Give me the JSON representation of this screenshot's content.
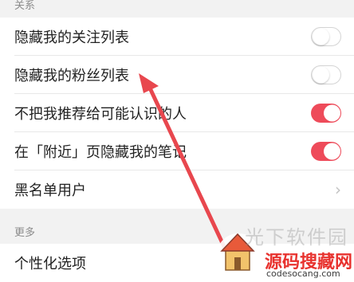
{
  "sections": [
    {
      "title": "关系",
      "items": [
        {
          "label": "隐藏我的关注列表",
          "control": "toggle",
          "on": false
        },
        {
          "label": "隐藏我的粉丝列表",
          "control": "toggle",
          "on": false
        },
        {
          "label": "不把我推荐给可能认识的人",
          "control": "toggle",
          "on": true
        },
        {
          "label": "在「附近」页隐藏我的笔记",
          "control": "toggle",
          "on": true
        },
        {
          "label": "黑名单用户",
          "control": "chevron"
        }
      ]
    },
    {
      "title": "更多",
      "items": [
        {
          "label": "个性化选项",
          "control": "none"
        }
      ]
    }
  ],
  "colors": {
    "accent": "#ee4b5a",
    "annotation_arrow": "#e8474e"
  },
  "icons": {
    "chevron": "chevron-right-icon"
  },
  "watermark": {
    "text": "光下软件园",
    "brand_name": "源码搜藏网",
    "brand_url": "codesocang.com"
  }
}
